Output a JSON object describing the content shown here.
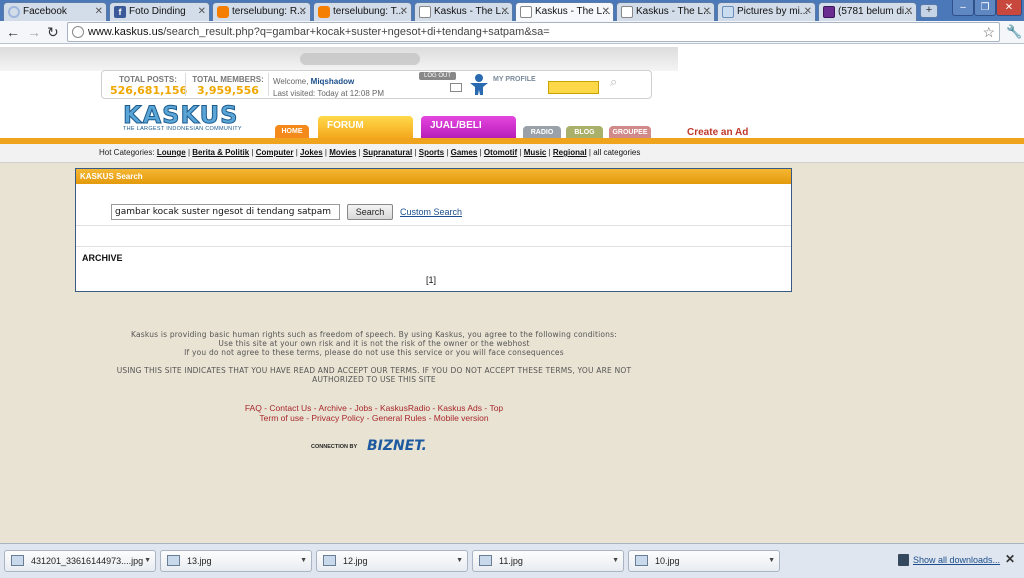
{
  "browser": {
    "tabs": [
      {
        "label": "Facebook",
        "icon": "facebook-loading-icon"
      },
      {
        "label": "Foto Dinding",
        "icon": "facebook-icon"
      },
      {
        "label": "terselubung: R...",
        "icon": "blogger-icon"
      },
      {
        "label": "terselubung: T...",
        "icon": "blogger-icon"
      },
      {
        "label": "Kaskus - The L...",
        "icon": "kaskus-icon"
      },
      {
        "label": "Kaskus - The L...",
        "icon": "kaskus-icon",
        "active": true
      },
      {
        "label": "Kaskus - The L...",
        "icon": "kaskus-icon"
      },
      {
        "label": "Pictures by mi...",
        "icon": "photo-icon"
      },
      {
        "label": "(5781 belum di...",
        "icon": "mail-icon"
      }
    ],
    "url_host": "www.kaskus.us",
    "url_path": "/search_result.php?q=gambar+kocak+suster+ngesot+di+tendang+satpam&sa="
  },
  "header": {
    "total_posts_label": "TOTAL POSTS:",
    "total_posts": "526,681,156",
    "total_members_label": "TOTAL MEMBERS:",
    "total_members": "3,959,556",
    "welcome_prefix": "Welcome,",
    "username": "Miqshadow",
    "last_visited": "Last visited: Today at 12:08 PM",
    "logout_label": "LOG OUT",
    "my_profile_label": "MY PROFILE",
    "logo_text": "KASKUS",
    "logo_tagline": "THE LARGEST INDONESIAN COMMUNITY",
    "nav": {
      "home": "HOME",
      "forum": "FORUM",
      "jualbeli": "JUAL/BELI",
      "radio": "RADIO",
      "blog": "BLOG",
      "groupee": "GROUPEE"
    },
    "create_ad": "Create an Ad"
  },
  "hot_categories": {
    "label": "Hot Categories:",
    "items": [
      "Lounge",
      "Berita & Politik",
      "Computer",
      "Jokes",
      "Movies",
      "Supranatural",
      "Sports",
      "Games",
      "Otomotif",
      "Music",
      "Regional"
    ],
    "all": "all categories"
  },
  "search": {
    "title": "KASKUS Search",
    "query": "gambar kocak suster ngesot di tendang satpam",
    "button": "Search",
    "custom": "Custom Search",
    "archive": "ARCHIVE",
    "page": "[1]"
  },
  "footer": {
    "terms_line1": "Kaskus is providing basic human rights such as freedom of speech. By using Kaskus, you agree to the following conditions:",
    "terms_line2": "Use this site at your own risk and it is not the risk of the owner or the webhost",
    "terms_line3": "If you do not agree to these terms, please do not use this service or you will face consequences",
    "terms_caps": "USING THIS SITE INDICATES THAT YOU HAVE READ AND ACCEPT OUR TERMS. IF YOU DO NOT ACCEPT THESE TERMS, YOU ARE NOT AUTHORIZED TO USE THIS SITE",
    "links_row1": [
      "FAQ",
      "Contact Us",
      "Archive",
      "Jobs",
      "KaskusRadio",
      "Kaskus Ads",
      "Top"
    ],
    "links_row2": [
      "Term of use",
      "Privacy Policy",
      "General Rules",
      "Mobile version"
    ],
    "connection_by": "CONNECTION BY",
    "biznet": "BIZNET."
  },
  "downloads": {
    "items": [
      "431201_33616144973....jpg",
      "13.jpg",
      "12.jpg",
      "11.jpg",
      "10.jpg"
    ],
    "show_all": "Show all downloads..."
  }
}
